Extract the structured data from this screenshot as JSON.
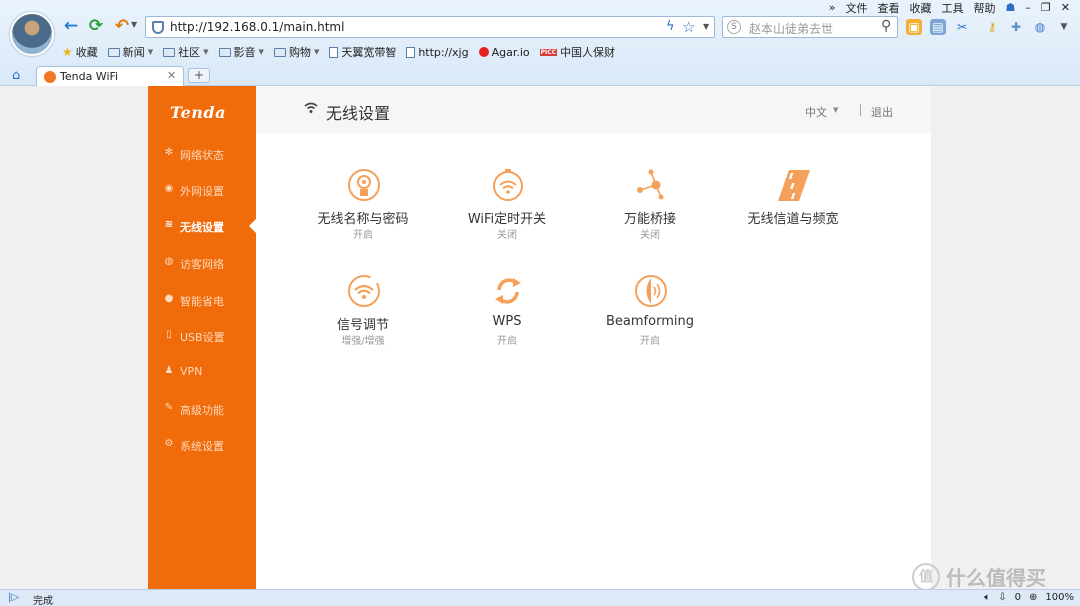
{
  "browser": {
    "menu": [
      "»",
      "文件",
      "查看",
      "收藏",
      "工具",
      "帮助"
    ],
    "url": "http://192.168.0.1/main.html",
    "search_placeholder": "赵本山徒弟去世",
    "bookmarks": [
      {
        "label": "收藏",
        "kind": "star"
      },
      {
        "label": "新闻",
        "kind": "folder"
      },
      {
        "label": "社区",
        "kind": "folder"
      },
      {
        "label": "影音",
        "kind": "folder"
      },
      {
        "label": "购物",
        "kind": "folder"
      },
      {
        "label": "天翼宽带智",
        "kind": "page"
      },
      {
        "label": "http://xjg",
        "kind": "page"
      },
      {
        "label": "Agar.io",
        "kind": "dot"
      },
      {
        "label": "中国人保财",
        "kind": "pic"
      }
    ],
    "tab_title": "Tenda WiFi",
    "status_text": "完成",
    "zoom": "100%",
    "download_count": "0"
  },
  "sidebar": {
    "logo": "Tenda",
    "items": [
      {
        "label": "网络状态",
        "icon": "✻"
      },
      {
        "label": "外网设置",
        "icon": "◉"
      },
      {
        "label": "无线设置",
        "icon": "≋",
        "active": true
      },
      {
        "label": "访客网络",
        "icon": "◍"
      },
      {
        "label": "智能省电",
        "icon": "●"
      },
      {
        "label": "USB设置",
        "icon": "▯"
      },
      {
        "label": "VPN",
        "icon": "♟"
      },
      {
        "label": "高级功能",
        "icon": "✎"
      },
      {
        "label": "系统设置",
        "icon": "⚙"
      }
    ]
  },
  "header": {
    "title": "无线设置",
    "language": "中文",
    "logout": "退出"
  },
  "cards": [
    {
      "name": "无线名称与密码",
      "status": "开启",
      "icon": "wifi-name-password-icon"
    },
    {
      "name": "WiFi定时开关",
      "status": "关闭",
      "icon": "wifi-timer-icon"
    },
    {
      "name": "万能桥接",
      "status": "关闭",
      "icon": "bridge-icon"
    },
    {
      "name": "无线信道与频宽",
      "status": "",
      "icon": "channel-road-icon"
    },
    {
      "name": "信号调节",
      "status": "增强/增强",
      "icon": "signal-adjust-icon"
    },
    {
      "name": "WPS",
      "status": "开启",
      "icon": "wps-refresh-icon"
    },
    {
      "name": "Beamforming",
      "status": "开启",
      "icon": "beamforming-icon"
    }
  ],
  "colors": {
    "accent": "#f06b0a",
    "icon_orange": "#f5a05a"
  },
  "watermark": "什么值得买"
}
